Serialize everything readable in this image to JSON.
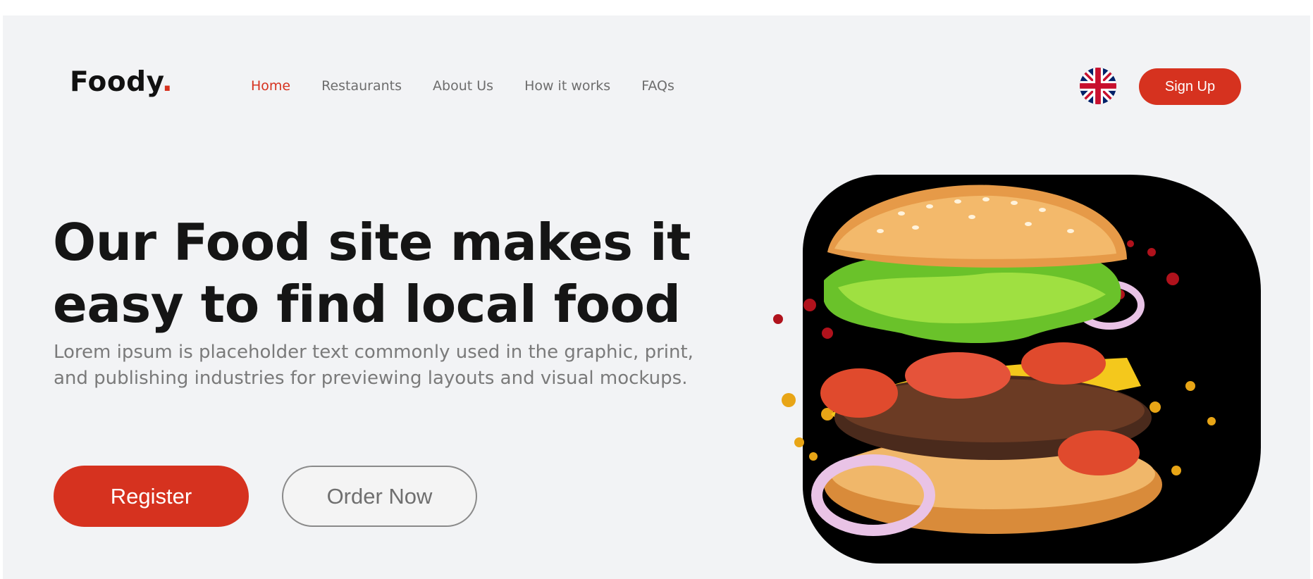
{
  "header": {
    "logo_text": "Foody",
    "logo_dot": ".",
    "nav": [
      {
        "label": "Home",
        "active": true
      },
      {
        "label": "Restaurants",
        "active": false
      },
      {
        "label": "About Us",
        "active": false
      },
      {
        "label": "How it works",
        "active": false
      },
      {
        "label": "FAQs",
        "active": false
      }
    ],
    "language_icon": "uk-flag-icon",
    "signup_label": "Sign Up"
  },
  "hero": {
    "title": "Our Food site makes it easy to find local food",
    "subtitle": "Lorem ipsum is placeholder text commonly used in the graphic, print, and publishing industries for previewing layouts and visual mockups.",
    "register_label": "Register",
    "order_label": "Order Now",
    "image_subject": "burger"
  },
  "colors": {
    "accent": "#d6321f",
    "background": "#f2f3f5",
    "text_dark": "#151515",
    "text_muted": "#7a7a7a"
  }
}
